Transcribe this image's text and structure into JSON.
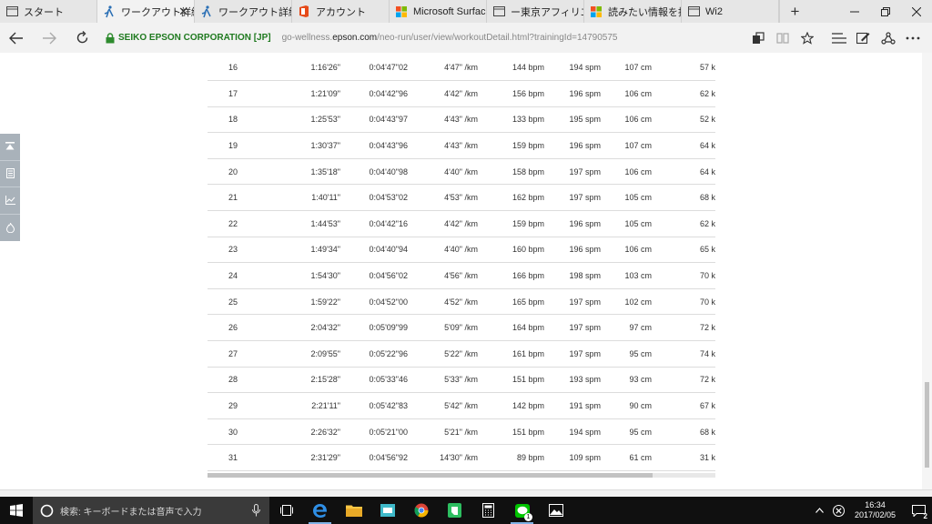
{
  "tabs": [
    {
      "label": "スタート",
      "active": false,
      "icon": "page-icon"
    },
    {
      "label": "ワークアウト詳細",
      "active": true,
      "icon": "runner-icon"
    },
    {
      "label": "ワークアウト詳細 - N",
      "active": false,
      "icon": "runner-icon"
    },
    {
      "label": "アカウント",
      "active": false,
      "icon": "office-icon"
    },
    {
      "label": "Microsoft Surface",
      "active": false,
      "icon": "microsoft-icon"
    },
    {
      "label": "ー東京アフィリエイト",
      "active": false,
      "icon": "page-icon"
    },
    {
      "label": "読みたい情報を持ち",
      "active": false,
      "icon": "microsoft-icon"
    },
    {
      "label": "Wi2",
      "active": false,
      "icon": "page-icon"
    }
  ],
  "address": {
    "site_identity": "SEIKO EPSON CORPORATION [JP]",
    "url_prefix": "go-wellness.",
    "url_host": "epson.com",
    "url_path": "/neo-run/user/view/workoutDetail.html?trainingId=14790575"
  },
  "laps": [
    {
      "lap": "16",
      "time": "1:16'26\"",
      "split": "0:04'47\"02",
      "pace": "4'47\" /km",
      "hr": "144 bpm",
      "cadence": "194 spm",
      "stride": "107 cm",
      "kcal": "57 k"
    },
    {
      "lap": "17",
      "time": "1:21'09\"",
      "split": "0:04'42\"96",
      "pace": "4'42\" /km",
      "hr": "156 bpm",
      "cadence": "196 spm",
      "stride": "106 cm",
      "kcal": "62 k"
    },
    {
      "lap": "18",
      "time": "1:25'53\"",
      "split": "0:04'43\"97",
      "pace": "4'43\" /km",
      "hr": "133 bpm",
      "cadence": "195 spm",
      "stride": "106 cm",
      "kcal": "52 k"
    },
    {
      "lap": "19",
      "time": "1:30'37\"",
      "split": "0:04'43\"96",
      "pace": "4'43\" /km",
      "hr": "159 bpm",
      "cadence": "196 spm",
      "stride": "107 cm",
      "kcal": "64 k"
    },
    {
      "lap": "20",
      "time": "1:35'18\"",
      "split": "0:04'40\"98",
      "pace": "4'40\" /km",
      "hr": "158 bpm",
      "cadence": "197 spm",
      "stride": "106 cm",
      "kcal": "64 k"
    },
    {
      "lap": "21",
      "time": "1:40'11\"",
      "split": "0:04'53\"02",
      "pace": "4'53\" /km",
      "hr": "162 bpm",
      "cadence": "197 spm",
      "stride": "105 cm",
      "kcal": "68 k"
    },
    {
      "lap": "22",
      "time": "1:44'53\"",
      "split": "0:04'42\"16",
      "pace": "4'42\" /km",
      "hr": "159 bpm",
      "cadence": "196 spm",
      "stride": "105 cm",
      "kcal": "62 k"
    },
    {
      "lap": "23",
      "time": "1:49'34\"",
      "split": "0:04'40\"94",
      "pace": "4'40\" /km",
      "hr": "160 bpm",
      "cadence": "196 spm",
      "stride": "106 cm",
      "kcal": "65 k"
    },
    {
      "lap": "24",
      "time": "1:54'30\"",
      "split": "0:04'56\"02",
      "pace": "4'56\" /km",
      "hr": "166 bpm",
      "cadence": "198 spm",
      "stride": "103 cm",
      "kcal": "70 k"
    },
    {
      "lap": "25",
      "time": "1:59'22\"",
      "split": "0:04'52\"00",
      "pace": "4'52\" /km",
      "hr": "165 bpm",
      "cadence": "197 spm",
      "stride": "102 cm",
      "kcal": "70 k"
    },
    {
      "lap": "26",
      "time": "2:04'32\"",
      "split": "0:05'09\"99",
      "pace": "5'09\" /km",
      "hr": "164 bpm",
      "cadence": "197 spm",
      "stride": "97 cm",
      "kcal": "72 k"
    },
    {
      "lap": "27",
      "time": "2:09'55\"",
      "split": "0:05'22\"96",
      "pace": "5'22\" /km",
      "hr": "161 bpm",
      "cadence": "197 spm",
      "stride": "95 cm",
      "kcal": "74 k"
    },
    {
      "lap": "28",
      "time": "2:15'28\"",
      "split": "0:05'33\"46",
      "pace": "5'33\" /km",
      "hr": "151 bpm",
      "cadence": "193 spm",
      "stride": "93 cm",
      "kcal": "72 k"
    },
    {
      "lap": "29",
      "time": "2:21'11\"",
      "split": "0:05'42\"83",
      "pace": "5'42\" /km",
      "hr": "142 bpm",
      "cadence": "191 spm",
      "stride": "90 cm",
      "kcal": "67 k"
    },
    {
      "lap": "30",
      "time": "2:26'32\"",
      "split": "0:05'21\"00",
      "pace": "5'21\" /km",
      "hr": "151 bpm",
      "cadence": "194 spm",
      "stride": "95 cm",
      "kcal": "68 k"
    },
    {
      "lap": "31",
      "time": "2:31'29\"",
      "split": "0:04'56\"92",
      "pace": "14'30\" /km",
      "hr": "89 bpm",
      "cadence": "109 spm",
      "stride": "61 cm",
      "kcal": "31 k"
    }
  ],
  "taskbar": {
    "search_placeholder": "検索: キーボードまたは音声で入力",
    "clock_time": "16:34",
    "clock_date": "2017/02/05",
    "notification_count": "2",
    "line_badge": "1"
  },
  "colors": {
    "accent": "#0078d7",
    "site_identity": "#1f7a1f",
    "side_tools": "#a9b2ba",
    "taskbar": "#101010"
  }
}
